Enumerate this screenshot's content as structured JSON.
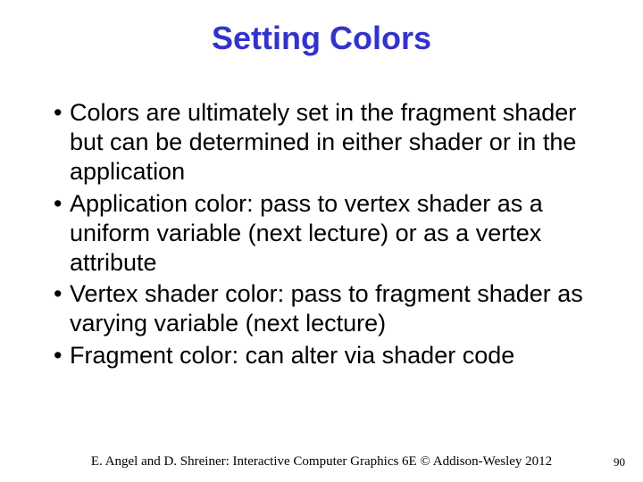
{
  "title": "Setting Colors",
  "bullets": [
    "Colors are ultimately set in the fragment shader but can be determined in either shader or in the application",
    "Application color: pass to vertex shader as a uniform variable (next lecture) or as a vertex attribute",
    "Vertex shader color: pass to fragment shader as varying variable (next lecture)",
    "Fragment color: can alter via shader code"
  ],
  "footer": "E. Angel and D. Shreiner: Interactive Computer Graphics 6E © Addison-Wesley 2012",
  "page": "90"
}
